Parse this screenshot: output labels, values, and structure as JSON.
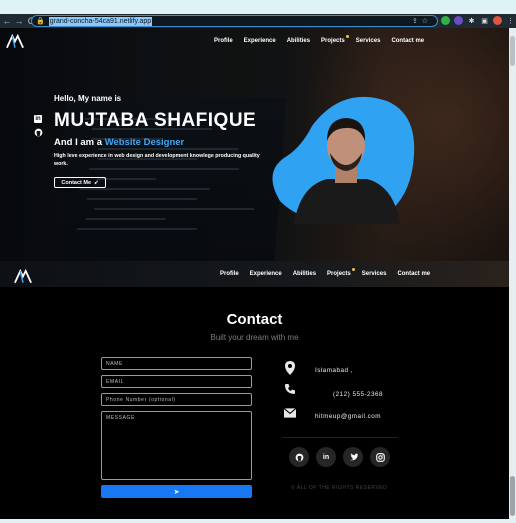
{
  "browser": {
    "url": "grand-concha-54ca91.netlify.app"
  },
  "nav": {
    "links": [
      "Profile",
      "Experience",
      "Abilities",
      "Projects",
      "Services",
      "Contact me"
    ]
  },
  "hero": {
    "greeting": "Hello, My name is",
    "name": "MUJTABA SHAFIQUE",
    "role_prefix": "And I am a",
    "role": "Website Designer",
    "description": "High leve experience in web design and development knowlege producing quality work.",
    "cta_label": "Contact Me"
  },
  "contact": {
    "title": "Contact",
    "subtitle": "Built your dream with me",
    "form": {
      "name_placeholder": "NAME",
      "email_placeholder": "EMAIL",
      "phone_placeholder": "Phone Number (optional)",
      "message_placeholder": "MESSAGE",
      "send_icon": "paper-plane-icon"
    },
    "info": {
      "location": "Islamabad ,",
      "phone": "(212) 555-2368",
      "email": "hitmeup@gmail.com"
    },
    "socials": [
      "github-icon",
      "linkedin-icon",
      "twitter-icon",
      "instagram-icon"
    ],
    "copyright": "© ALL OF THE RIGHTS RESERVED"
  },
  "colors": {
    "accent": "#3fa9f5",
    "button": "#1877f2",
    "portrait_blob": "#2fa3f2",
    "nav_dot": "#f5c04a"
  }
}
